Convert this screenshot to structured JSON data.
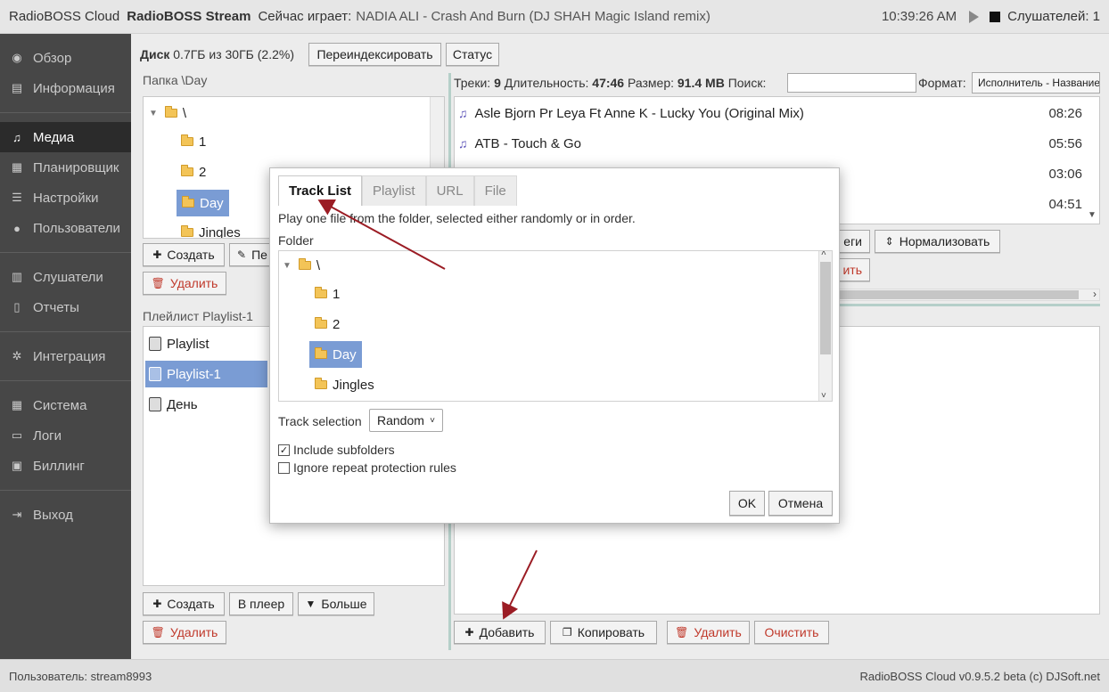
{
  "header": {
    "brand": "RadioBOSS Cloud",
    "stream": "RadioBOSS Stream",
    "now_playing_label": "Сейчас играет:",
    "now_playing_track": "NADIA ALI - Crash And Burn (DJ SHAH Magic Island remix)",
    "time": "10:39:26 AM",
    "listeners": "Слушателей: 1"
  },
  "sidebar": {
    "items": [
      {
        "label": "Обзор",
        "icon": "dashboard-icon"
      },
      {
        "label": "Информация",
        "icon": "book-icon"
      },
      {
        "label": "Медиа",
        "icon": "music-note-icon"
      },
      {
        "label": "Планировщик",
        "icon": "calendar-icon"
      },
      {
        "label": "Настройки",
        "icon": "sliders-icon"
      },
      {
        "label": "Пользователи",
        "icon": "user-icon"
      },
      {
        "label": "Слушатели",
        "icon": "bar-chart-icon"
      },
      {
        "label": "Отчеты",
        "icon": "document-icon"
      },
      {
        "label": "Интеграция",
        "icon": "gears-icon"
      },
      {
        "label": "Система",
        "icon": "grid-icon"
      },
      {
        "label": "Логи",
        "icon": "folder-icon"
      },
      {
        "label": "Биллинг",
        "icon": "money-icon"
      },
      {
        "label": "Выход",
        "icon": "logout-icon"
      }
    ],
    "active": "Медиа"
  },
  "disk": {
    "label": "Диск",
    "usage": "0.7ГБ из 30ГБ (2.2%)",
    "reindex_button": "Переиндексировать",
    "status_button": "Статус"
  },
  "folder_panel": {
    "label": "Папка",
    "path": "\\Day",
    "tree": [
      "\\",
      "1",
      "2",
      "Day",
      "Jingles"
    ],
    "selected": "Day",
    "create_button": "Создать",
    "edit_button_partial": "Пе",
    "delete_button": "Удалить"
  },
  "tracks_panel": {
    "tracks_label": "Треки:",
    "tracks_count": "9",
    "duration_label": "Длительность:",
    "duration": "47:46",
    "size_label": "Размер:",
    "size": "91.4 MB",
    "search_label": "Поиск:",
    "format_label": "Формат:",
    "format_value": "Исполнитель - Название",
    "tracks": [
      {
        "title": "Asle Bjorn Pr Leya Ft Anne K - Lucky You (Original Mix)",
        "duration": "08:26"
      },
      {
        "title": "ATB - Touch & Go",
        "duration": "05:56"
      },
      {
        "title": "",
        "duration": "03:06"
      },
      {
        "title": "",
        "duration": "04:51"
      }
    ],
    "tags_button_partial": "еги",
    "normalize_button": "Нормализовать",
    "partial_button": "ить"
  },
  "playlist_panel": {
    "label": "Плейлист",
    "name": "Playlist-1",
    "items": [
      "Playlist",
      "Playlist-1",
      "День"
    ],
    "selected": "Playlist-1",
    "create_button": "Создать",
    "to_player_button": "В плеер",
    "more_button": "Больше",
    "delete_button": "Удалить"
  },
  "playlist_actions": {
    "add_button": "Добавить",
    "copy_button": "Копировать",
    "delete_button": "Удалить",
    "clear_button": "Очистить"
  },
  "modal": {
    "tabs": [
      "Track List",
      "Playlist",
      "URL",
      "File"
    ],
    "active_tab": "Track List",
    "description": "Play one file from the folder, selected either randomly or in order.",
    "folder_label": "Folder",
    "tree": [
      "\\",
      "1",
      "2",
      "Day",
      "Jingles"
    ],
    "selected": "Day",
    "track_selection_label": "Track selection",
    "track_selection_value": "Random",
    "include_subfolders": "Include subfolders",
    "include_subfolders_checked": true,
    "ignore_repeat": "Ignore repeat protection rules",
    "ignore_repeat_checked": false,
    "ok_button": "OK",
    "cancel_button": "Отмена"
  },
  "footer": {
    "user": "Пользователь: stream8993",
    "version": "RadioBOSS Cloud v0.9.5.2 beta (c) DJSoft.net"
  },
  "colors": {
    "selection": "#7a9cd4",
    "sidebar_bg": "#474747",
    "danger": "#c0392b",
    "annotation_arrow": "#9b1c24"
  }
}
